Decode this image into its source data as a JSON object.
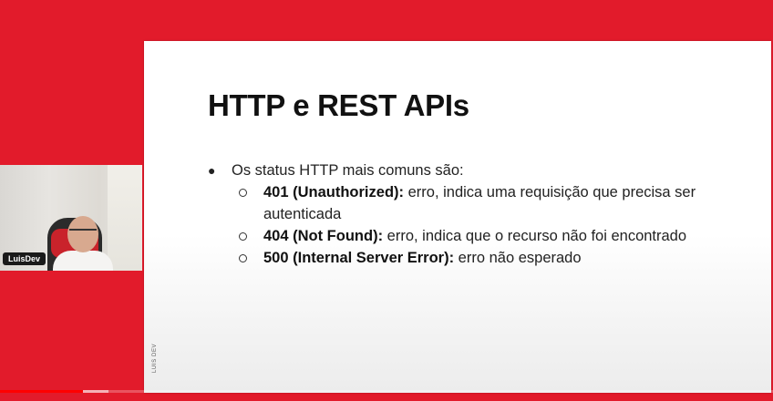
{
  "slide": {
    "title": "HTTP e REST APIs",
    "intro": "Os status HTTP mais comuns são:",
    "items": [
      {
        "code": "401 (Unauthorized):",
        "desc": " erro, indica uma requisição que precisa ser autenticada"
      },
      {
        "code": "404 (Not Found):",
        "desc": " erro, indica que o recurso não foi encontrado"
      },
      {
        "code": "500 (Internal Server Error):",
        "desc": " erro não esperado"
      }
    ],
    "footer_brand": "LUIS DEV"
  },
  "webcam": {
    "name_label": "LuisDev"
  },
  "player": {
    "played_fraction": 0.107,
    "buffered_fraction": 0.14
  },
  "colors": {
    "background": "#e21b2b",
    "progress_played": "#ff0000"
  }
}
